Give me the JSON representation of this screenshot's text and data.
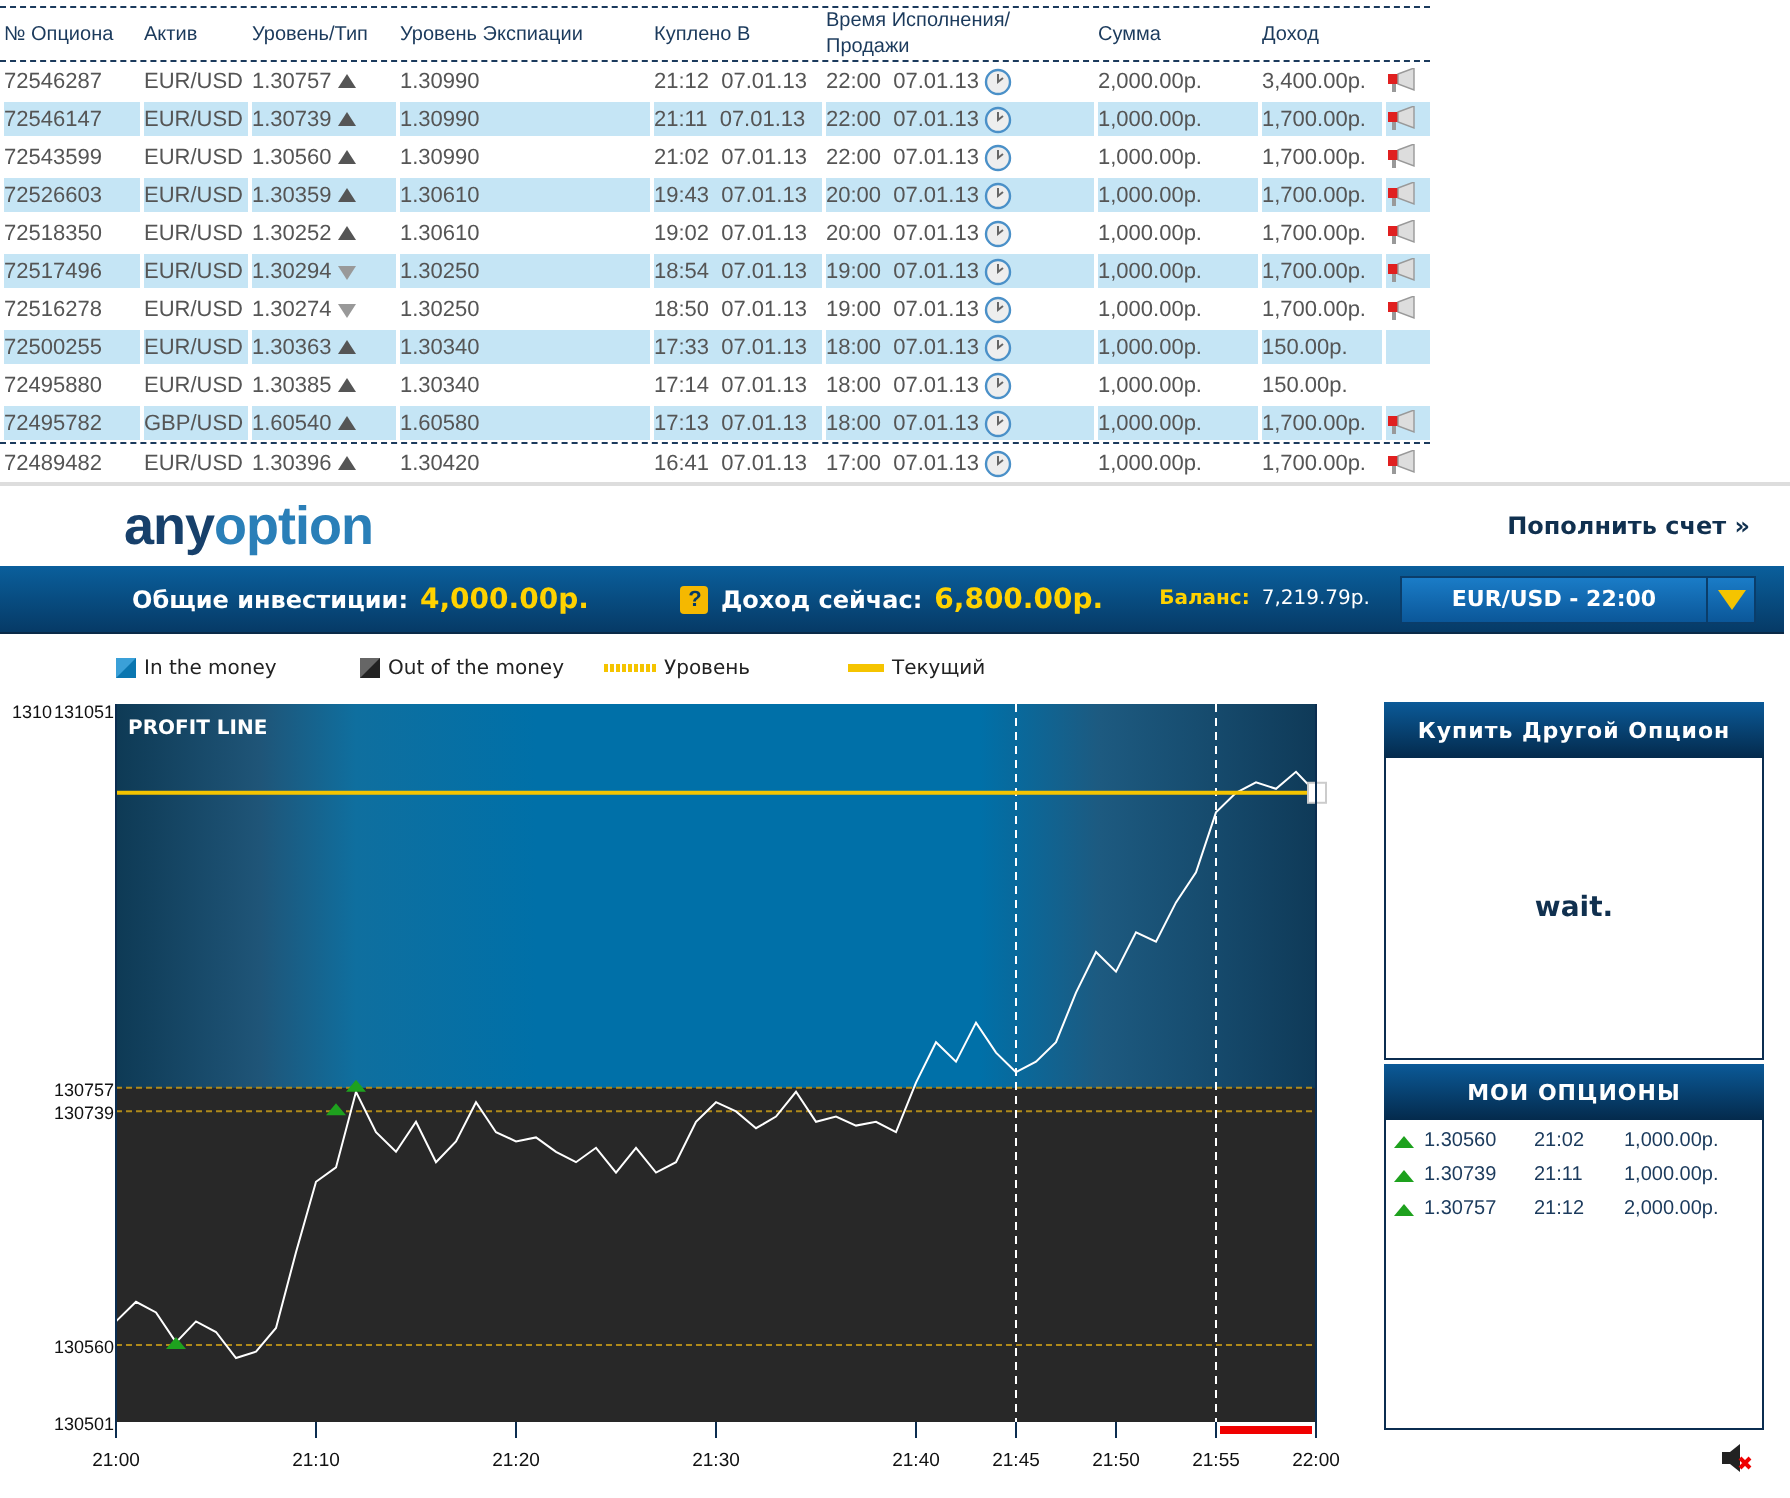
{
  "table": {
    "columns": [
      "№ Опциона",
      "Актив",
      "Уровень/Тип",
      "Уровень Экспиации",
      "Куплено В",
      "Время Исполнения/ Продажи",
      "Сумма",
      "Доход"
    ],
    "rows": [
      {
        "id": "72546287",
        "asset": "EUR/USD",
        "level": "1.30757",
        "up": true,
        "expiry_level": "1.30990",
        "bought": "21:12  07.01.13",
        "expires": "22:00  07.01.13",
        "amount": "2,000.00р.",
        "income": "3,400.00р.",
        "alert": true
      },
      {
        "id": "72546147",
        "asset": "EUR/USD",
        "level": "1.30739",
        "up": true,
        "expiry_level": "1.30990",
        "bought": "21:11  07.01.13",
        "expires": "22:00  07.01.13",
        "amount": "1,000.00р.",
        "income": "1,700.00р.",
        "alert": true
      },
      {
        "id": "72543599",
        "asset": "EUR/USD",
        "level": "1.30560",
        "up": true,
        "expiry_level": "1.30990",
        "bought": "21:02  07.01.13",
        "expires": "22:00  07.01.13",
        "amount": "1,000.00р.",
        "income": "1,700.00р.",
        "alert": true
      },
      {
        "id": "72526603",
        "asset": "EUR/USD",
        "level": "1.30359",
        "up": true,
        "expiry_level": "1.30610",
        "bought": "19:43  07.01.13",
        "expires": "20:00  07.01.13",
        "amount": "1,000.00р.",
        "income": "1,700.00р.",
        "alert": true
      },
      {
        "id": "72518350",
        "asset": "EUR/USD",
        "level": "1.30252",
        "up": true,
        "expiry_level": "1.30610",
        "bought": "19:02  07.01.13",
        "expires": "20:00  07.01.13",
        "amount": "1,000.00р.",
        "income": "1,700.00р.",
        "alert": true
      },
      {
        "id": "72517496",
        "asset": "EUR/USD",
        "level": "1.30294",
        "up": false,
        "expiry_level": "1.30250",
        "bought": "18:54  07.01.13",
        "expires": "19:00  07.01.13",
        "amount": "1,000.00р.",
        "income": "1,700.00р.",
        "alert": true
      },
      {
        "id": "72516278",
        "asset": "EUR/USD",
        "level": "1.30274",
        "up": false,
        "expiry_level": "1.30250",
        "bought": "18:50  07.01.13",
        "expires": "19:00  07.01.13",
        "amount": "1,000.00р.",
        "income": "1,700.00р.",
        "alert": true
      },
      {
        "id": "72500255",
        "asset": "EUR/USD",
        "level": "1.30363",
        "up": true,
        "expiry_level": "1.30340",
        "bought": "17:33  07.01.13",
        "expires": "18:00  07.01.13",
        "amount": "1,000.00р.",
        "income": "150.00р.",
        "alert": false
      },
      {
        "id": "72495880",
        "asset": "EUR/USD",
        "level": "1.30385",
        "up": true,
        "expiry_level": "1.30340",
        "bought": "17:14  07.01.13",
        "expires": "18:00  07.01.13",
        "amount": "1,000.00р.",
        "income": "150.00р.",
        "alert": false
      },
      {
        "id": "72495782",
        "asset": "GBP/USD",
        "level": "1.60540",
        "up": true,
        "expiry_level": "1.60580",
        "bought": "17:13  07.01.13",
        "expires": "18:00  07.01.13",
        "amount": "1,000.00р.",
        "income": "1,700.00р.",
        "alert": true
      },
      {
        "id": "72489482",
        "asset": "EUR/USD",
        "level": "1.30396",
        "up": true,
        "expiry_level": "1.30420",
        "bought": "16:41  07.01.13",
        "expires": "17:00  07.01.13",
        "amount": "1,000.00р.",
        "income": "1,700.00р.",
        "alert": true
      }
    ]
  },
  "header": {
    "logo_a": "any",
    "logo_b": "option",
    "deposit_link": "Пополнить счет »"
  },
  "summary": {
    "investments_label": "Общие инвестиции:",
    "investments": "4,000.00р.",
    "help": "?",
    "income_label": "Доход сейчас:",
    "income": "6,800.00р.",
    "balance_label": "Баланс:",
    "balance": "7,219.79р.",
    "asset_select": "EUR/USD - 22:00"
  },
  "legend": [
    {
      "kind": "in",
      "label": "In the money"
    },
    {
      "kind": "out",
      "label": "Out of the money"
    },
    {
      "kind": "level",
      "label": "Уровень"
    },
    {
      "kind": "current",
      "label": "Текущий"
    }
  ],
  "chart": {
    "overlap_label": "1310",
    "chart_data": {
      "type": "line",
      "title": "PROFIT LINE",
      "categories": [
        "21:00",
        null,
        null,
        null,
        null,
        null,
        null,
        null,
        null,
        null,
        "21:10",
        null,
        null,
        null,
        null,
        null,
        null,
        null,
        null,
        null,
        "21:20",
        null,
        null,
        null,
        null,
        null,
        null,
        null,
        null,
        null,
        "21:30",
        null,
        null,
        null,
        null,
        null,
        null,
        null,
        null,
        null,
        "21:40",
        null,
        null,
        null,
        null,
        "21:45",
        null,
        null,
        null,
        null,
        "21:50",
        null,
        null,
        null,
        null,
        "21:55",
        null,
        null,
        null,
        null,
        "22:00"
      ],
      "series": [
        {
          "color": "#ffffff",
          "values": [
            130578,
            130593,
            130585,
            130562,
            130578,
            130570,
            130550,
            130555,
            130573,
            130631,
            130685,
            130696,
            130754,
            130723,
            130708,
            130731,
            130700,
            130716,
            130746,
            130723,
            130716,
            130719,
            130708,
            130700,
            130711,
            130692,
            130711,
            130692,
            130700,
            130731,
            130746,
            130739,
            130726,
            130735,
            130754,
            130731,
            130735,
            130728,
            130731,
            130723,
            130761,
            130792,
            130777,
            130807,
            130784,
            130769,
            130777,
            130792,
            130830,
            130861,
            130846,
            130876,
            130869,
            130899,
            130922,
            130968,
            130983,
            130991,
            130986,
            130999,
            130983
          ]
        },
        {
          "type": "scatter",
          "color": "#1ea11e",
          "values": [
            null,
            null,
            null,
            130560,
            null,
            null,
            null,
            null,
            null,
            null,
            null,
            130739,
            130757,
            null,
            null,
            null,
            null,
            null,
            null,
            null,
            null,
            null,
            null,
            null,
            null,
            null,
            null,
            null,
            null,
            null,
            null,
            null,
            null,
            null,
            null,
            null,
            null,
            null,
            null,
            null,
            null,
            null,
            null,
            null,
            null,
            null,
            null,
            null,
            null,
            null,
            null,
            null,
            null,
            null,
            null,
            null,
            null,
            null,
            null,
            null,
            null
          ]
        }
      ],
      "grid": false,
      "ylim": [
        130501,
        131051
      ],
      "yticks": [
        130501,
        130560,
        130739,
        130757,
        131051
      ],
      "ref_lines": [
        {
          "axis": "y",
          "value": 130757,
          "color": "#b08a1a"
        },
        {
          "axis": "y",
          "value": 130739,
          "color": "#b08a1a"
        },
        {
          "axis": "y",
          "value": 130560,
          "color": "#b08a1a"
        },
        {
          "axis": "y",
          "value": 130983,
          "color": "#f5c400"
        },
        {
          "axis": "x",
          "value": "21:45",
          "color": "#ffffff"
        },
        {
          "axis": "x",
          "value": "21:55",
          "color": "#ffffff"
        }
      ],
      "bands": [
        {
          "axis": "y",
          "from": 130757,
          "to": 131051,
          "color": "#0070a8"
        }
      ]
    }
  },
  "buy_panel": {
    "title": "Купить Другой Опцион",
    "status": "wait."
  },
  "my_options": {
    "title": "МОИ ОПЦИОНЫ",
    "items": [
      {
        "up": true,
        "level": "1.30560",
        "time": "21:02",
        "amount": "1,000.00р."
      },
      {
        "up": true,
        "level": "1.30739",
        "time": "21:11",
        "amount": "1,000.00р."
      },
      {
        "up": true,
        "level": "1.30757",
        "time": "21:12",
        "amount": "2,000.00р."
      }
    ]
  }
}
